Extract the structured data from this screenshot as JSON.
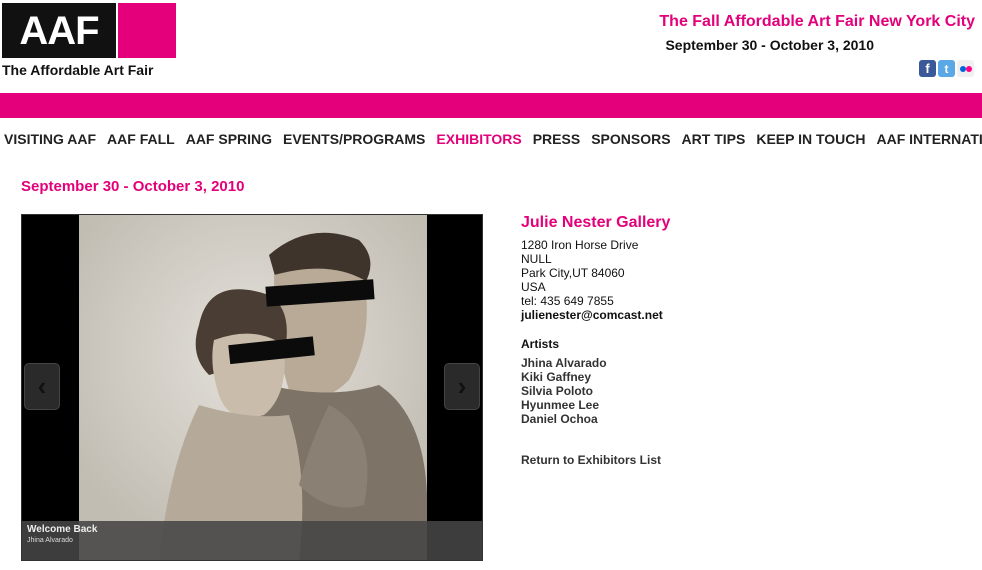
{
  "brand": {
    "logo_text": "AAF",
    "logo_subtitle": "The Affordable Art Fair",
    "accent_color": "#e3007a"
  },
  "header": {
    "event_title": "The Fall Affordable Art Fair New York City",
    "event_dates": "September 30 - October 3, 2010",
    "social": [
      {
        "icon": "facebook-icon",
        "glyph": "f"
      },
      {
        "icon": "twitter-icon",
        "glyph": "t"
      },
      {
        "icon": "flickr-icon",
        "glyph": ""
      }
    ]
  },
  "nav": {
    "items": [
      {
        "label": "VISITING AAF",
        "active": false
      },
      {
        "label": "AAF FALL",
        "active": false
      },
      {
        "label": "AAF SPRING",
        "active": false
      },
      {
        "label": "EVENTS/PROGRAMS",
        "active": false
      },
      {
        "label": "EXHIBITORS",
        "active": true
      },
      {
        "label": "PRESS",
        "active": false
      },
      {
        "label": "SPONSORS",
        "active": false
      },
      {
        "label": "ART TIPS",
        "active": false
      },
      {
        "label": "KEEP IN TOUCH",
        "active": false
      },
      {
        "label": "AAF INTERNATIONAL",
        "active": false
      }
    ]
  },
  "page": {
    "date": "September 30 - October 3, 2010"
  },
  "viewer": {
    "caption_title": "Welcome Back",
    "caption_artist": "Jhina Alvarado"
  },
  "gallery": {
    "name": "Julie Nester Gallery",
    "address_lines": [
      "1280 Iron Horse Drive",
      "NULL",
      "Park City,UT 84060",
      "USA",
      "tel: 435 649 7855"
    ],
    "email": "julienester@comcast.net",
    "artists_heading": "Artists",
    "artists": [
      "Jhina Alvarado",
      "Kiki Gaffney",
      "Silvia Poloto",
      "Hyunmee Lee",
      "Daniel Ochoa"
    ],
    "return_link": "Return to Exhibitors List"
  }
}
